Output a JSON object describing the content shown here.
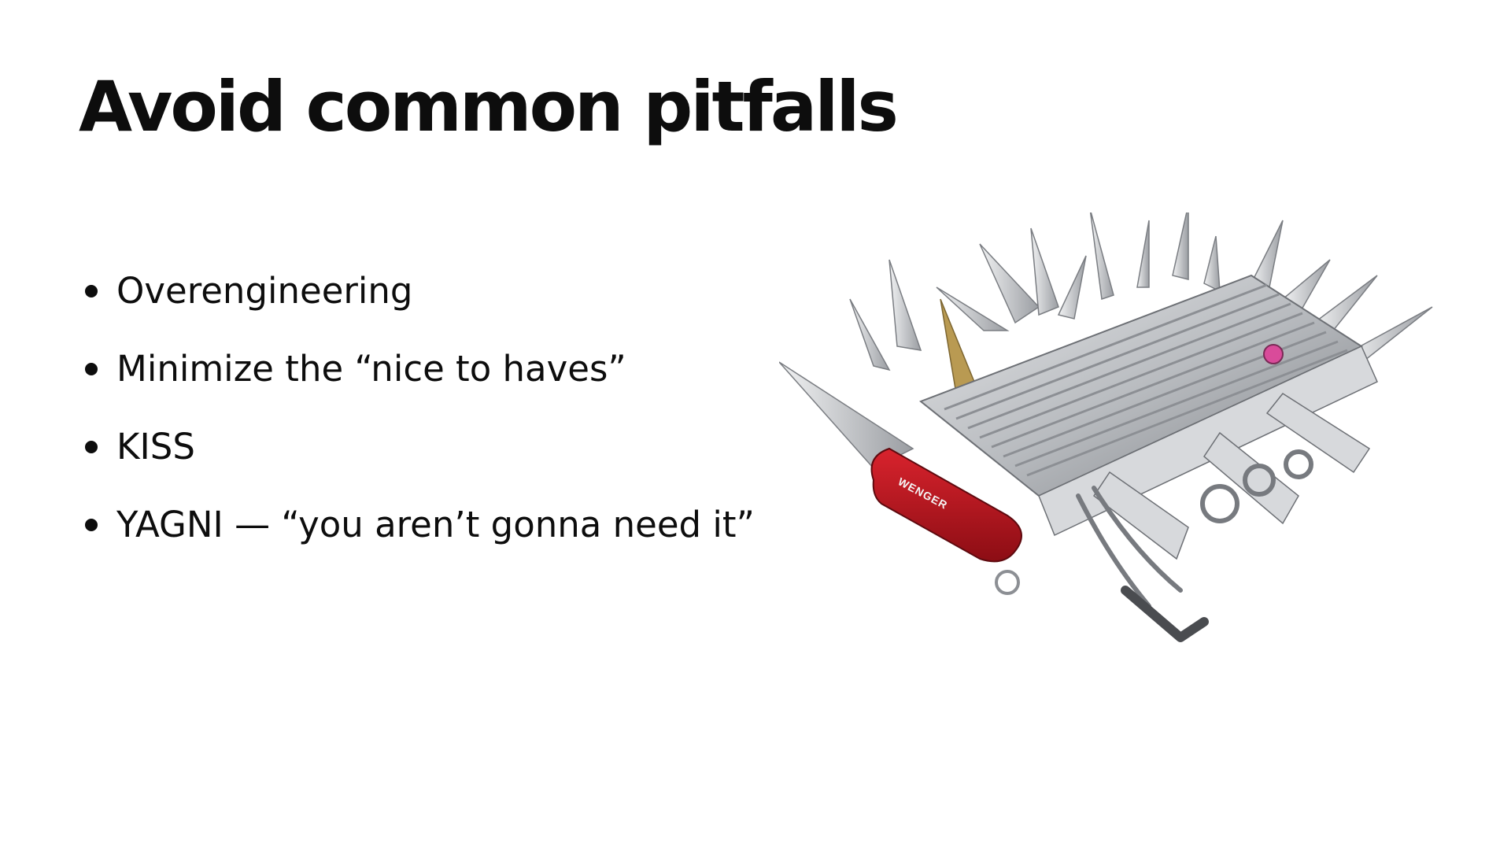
{
  "slide": {
    "title": "Avoid common pitfalls",
    "bullets": [
      "Overengineering",
      "Minimize the “nice to haves”",
      "KISS",
      "YAGNI — “you aren’t gonna need it”"
    ]
  },
  "image": {
    "subject": "oversized-swiss-army-knife",
    "brand_text": "WENGER",
    "colors": {
      "handle_red": "#b3121b",
      "steel": "#b9bcc0",
      "steel_dark": "#6d7075",
      "brass": "#b99a52"
    }
  }
}
